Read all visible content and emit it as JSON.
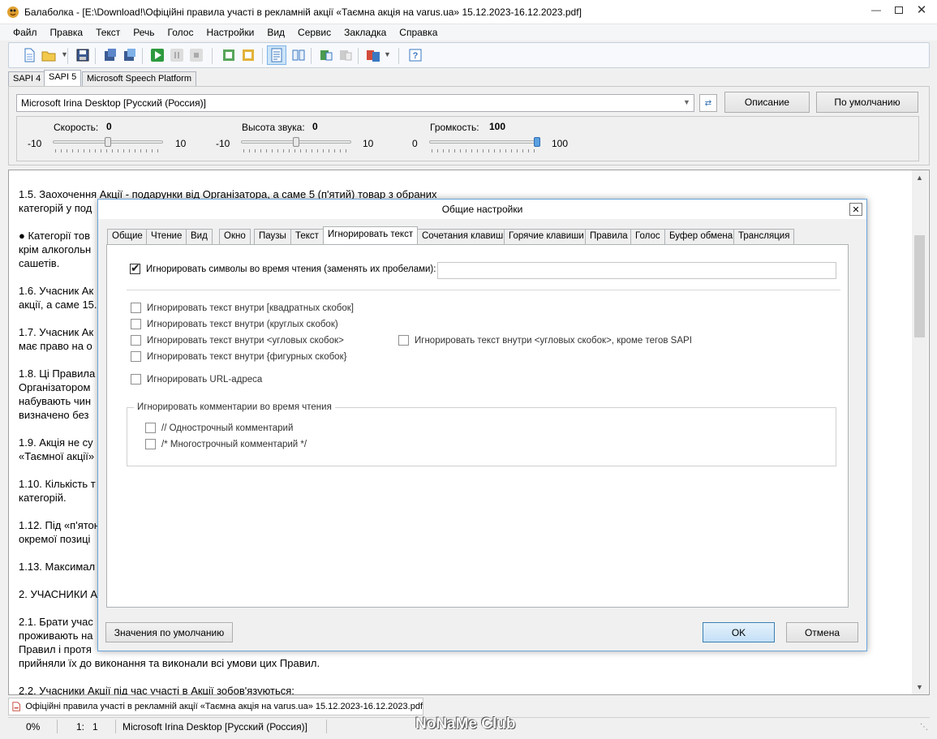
{
  "window": {
    "title": "Балаболка - [E:\\Download!\\Офіційні правила участі в рекламній акції «Таємна акція на varus.ua» 15.12.2023-16.12.2023.pdf]"
  },
  "menu": [
    "Файл",
    "Правка",
    "Текст",
    "Речь",
    "Голос",
    "Настройки",
    "Вид",
    "Сервис",
    "Закладка",
    "Справка"
  ],
  "sapi_tabs": [
    "SAPI 4",
    "SAPI 5",
    "Microsoft Speech Platform"
  ],
  "voice": {
    "selected": "Microsoft Irina Desktop [Русский (Россия)]",
    "describe_label": "Описание",
    "default_label": "По умолчанию"
  },
  "sliders": {
    "speed": {
      "label": "Скорость:",
      "value": "0",
      "min": "-10",
      "max": "10",
      "position": 0.5
    },
    "pitch": {
      "label": "Высота звука:",
      "value": "0",
      "min": "-10",
      "max": "10",
      "position": 0.5
    },
    "volume": {
      "label": "Громкость:",
      "value": "100",
      "min": "0",
      "max": "100",
      "position": 1.0
    }
  },
  "document_lines": [
    "1.5. Заохочення Акції - подарунки від Організатора, а саме 5 (п'ятий) товар з обраних",
    "категорій у под",
    "● Категорії тов",
    "крім алкогольн",
    "сашетів.",
    "1.6. Учасник Ак",
    "акції, а саме 15.",
    "1.7. Учасник Ак",
    "має право на о",
    "1.8. Ці Правила",
    "Організатором",
    "набувають чин",
    "визначено без",
    "1.9. Акція не су",
    "«Таємної акції»",
    "1.10. Кількість т",
    "категорій.",
    "1.12. Під «п'ятон",
    "окремої позиці",
    "1.13. Максимал",
    "2. УЧАСНИКИ А",
    "2.1. Брати учас",
    "проживають на",
    "Правил і протя",
    "прийняли їх до виконання та виконали всі умови цих Правил.",
    "2.2. Учасники Акції під час участі в Акції зобов'язуються:"
  ],
  "doc_tab": "Офіційні правила участі в рекламній акції «Таємна акція на varus.ua» 15.12.2023-16.12.2023.pdf",
  "status": {
    "percent": "0%",
    "position": "1:   1",
    "voice": "Microsoft Irina Desktop [Русский (Россия)]"
  },
  "dialog": {
    "title": "Общие настройки",
    "tabs": [
      "Общие",
      "Чтение",
      "Вид",
      "Окно",
      "Паузы",
      "Текст",
      "Игнорировать текст",
      "Сочетания клавиш",
      "Горячие клавиши",
      "Правила",
      "Голос",
      "Буфер обмена",
      "Трансляция"
    ],
    "active_tab": "Игнорировать текст",
    "ignore_chars": {
      "label": "Игнорировать символы во время чтения (заменять их пробелами):",
      "checked": true,
      "value": ""
    },
    "options": {
      "square": "Игнорировать текст внутри [квадратных скобок]",
      "round": "Игнорировать текст внутри (круглых скобок)",
      "angle": "Игнорировать текст внутри <угловых скобок>",
      "angle_sapi": "Игнорировать текст внутри <угловых скобок>, кроме тегов SAPI",
      "curly": "Игнорировать текст внутри {фигурных скобок}",
      "url": "Игнорировать URL-адреса"
    },
    "comments": {
      "legend": "Игнорировать комментарии во время чтения",
      "single": "// Однострочный комментарий",
      "multi": "/* Многострочный комментарий */"
    },
    "buttons": {
      "defaults": "Значения по умолчанию",
      "ok": "OK",
      "cancel": "Отмена"
    }
  },
  "watermark": "NoNaMe Club"
}
